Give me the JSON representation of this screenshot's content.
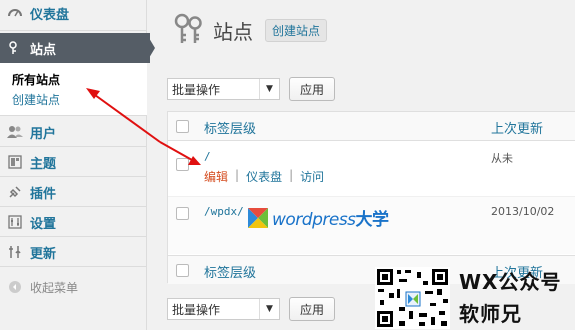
{
  "sidebar": {
    "dashboard": "仪表盘",
    "sites": "站点",
    "all_sites": "所有站点",
    "add_site": "创建站点",
    "users": "用户",
    "themes": "主题",
    "plugins": "插件",
    "settings": "设置",
    "updates": "更新",
    "collapse": "收起菜单"
  },
  "header": {
    "title": "站点",
    "add_new": "创建站点"
  },
  "bulk_actions": {
    "label": "批量操作",
    "apply": "应用"
  },
  "table": {
    "col_path": "标签层级",
    "col_updated": "上次更新",
    "rows": [
      {
        "path": "/",
        "updated": "从未",
        "actions": [
          "编辑",
          "仪表盘",
          "访问"
        ]
      },
      {
        "path": "/wpdx/",
        "updated": "2013/10/02"
      }
    ]
  },
  "watermark": {
    "text": "wordpress",
    "suffix": "大学"
  },
  "promo": {
    "line1": "WX公众号",
    "line2": "软师兄"
  },
  "colors": {
    "link": "#21759b",
    "annotation_arrow": "#e01010",
    "active_menu": "#555d66"
  }
}
